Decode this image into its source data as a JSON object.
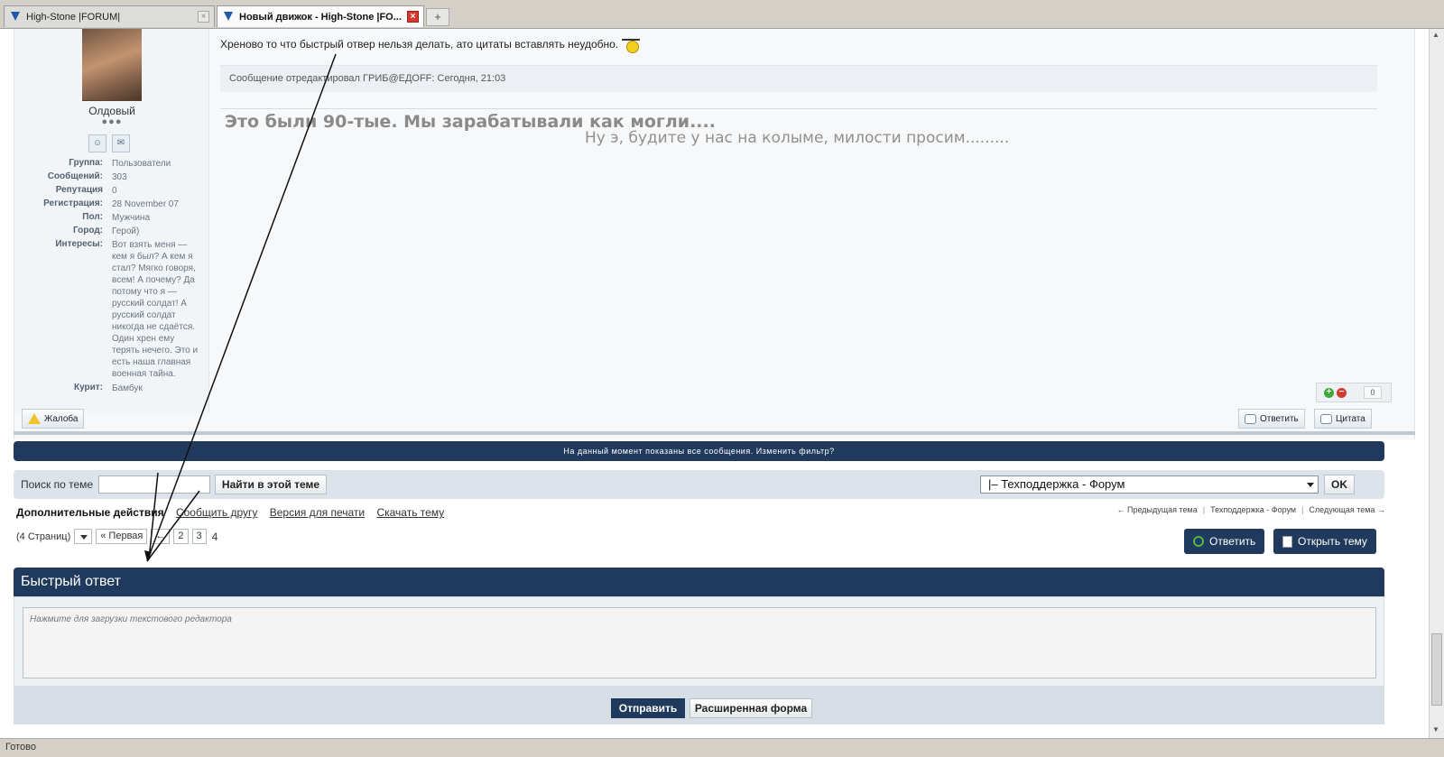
{
  "browser": {
    "tabs": [
      {
        "label": "High-Stone |FORUM|",
        "active": false
      },
      {
        "label": "Новый движок - High-Stone |FO...",
        "active": true
      }
    ],
    "new_tab": "+",
    "status": "Готово"
  },
  "post": {
    "author": {
      "name": "Олдовый",
      "pips": "●●●",
      "info": [
        {
          "key": "Группа:",
          "value": "Пользователи"
        },
        {
          "key": "Сообщений:",
          "value": "303"
        },
        {
          "key": "Репутация",
          "value": "0"
        },
        {
          "key": "Регистрация:",
          "value": "28 November 07"
        },
        {
          "key": "Пол:",
          "value": "Мужчина"
        },
        {
          "key": "Город:",
          "value": "Герой)"
        },
        {
          "key": "Интересы:",
          "value": "Вот взять меня — кем я был? А кем я стал? Мягко говоря, всем! А почему? Да потому что я — русский солдат! А русский солдат никогда не сдаётся. Один хрен ему терять нечего. Это и есть наша главная военная тайна."
        },
        {
          "key": "Курит:",
          "value": "Бамбук"
        }
      ]
    },
    "message": "Хреново то что быстрый отвер нельзя делать, ато цитаты вставлять неудобно.",
    "edit_note": "Сообщение отредактировал ГРИБ@ЕДOFF: Сегодня, 21:03",
    "signature_bold": "Это были 90-тые. Мы зарабатывали как могли....",
    "signature_text": "Ну э, будите у нас на колыме, милости просим.........",
    "rep_count": "0",
    "report_label": "Жалоба",
    "reply_label": "Ответить",
    "quote_label": "Цитата"
  },
  "filter_bar": "На данный момент показаны все сообщения. Изменить фильтр?",
  "search": {
    "label": "Поиск по теме",
    "value": "",
    "button": "Найти в этой теме",
    "forum_selected": "|– Техподдержка - Форум",
    "ok": "OK"
  },
  "actions": {
    "title": "Дополнительные действия",
    "links": [
      "Сообщить другу",
      "Версия для печати",
      "Скачать тему"
    ]
  },
  "topic_nav": [
    "← Предыдущая тема",
    "Техподдержка - Форум",
    "Следующая тема →"
  ],
  "pagination": {
    "label": "(4 Страниц)",
    "first": "« Первая",
    "prev": "←",
    "pages": [
      "2",
      "3"
    ],
    "current": "4"
  },
  "topic_buttons": {
    "reply": "Ответить",
    "new_topic": "Открыть тему"
  },
  "quick_reply": {
    "title": "Быстрый ответ",
    "placeholder": "Нажмите для загрузки текстового редактора",
    "send": "Отправить",
    "advanced": "Расширенная форма"
  },
  "colors": {
    "dark_blue": "#1f3a5c",
    "panel": "#dde3ea"
  }
}
